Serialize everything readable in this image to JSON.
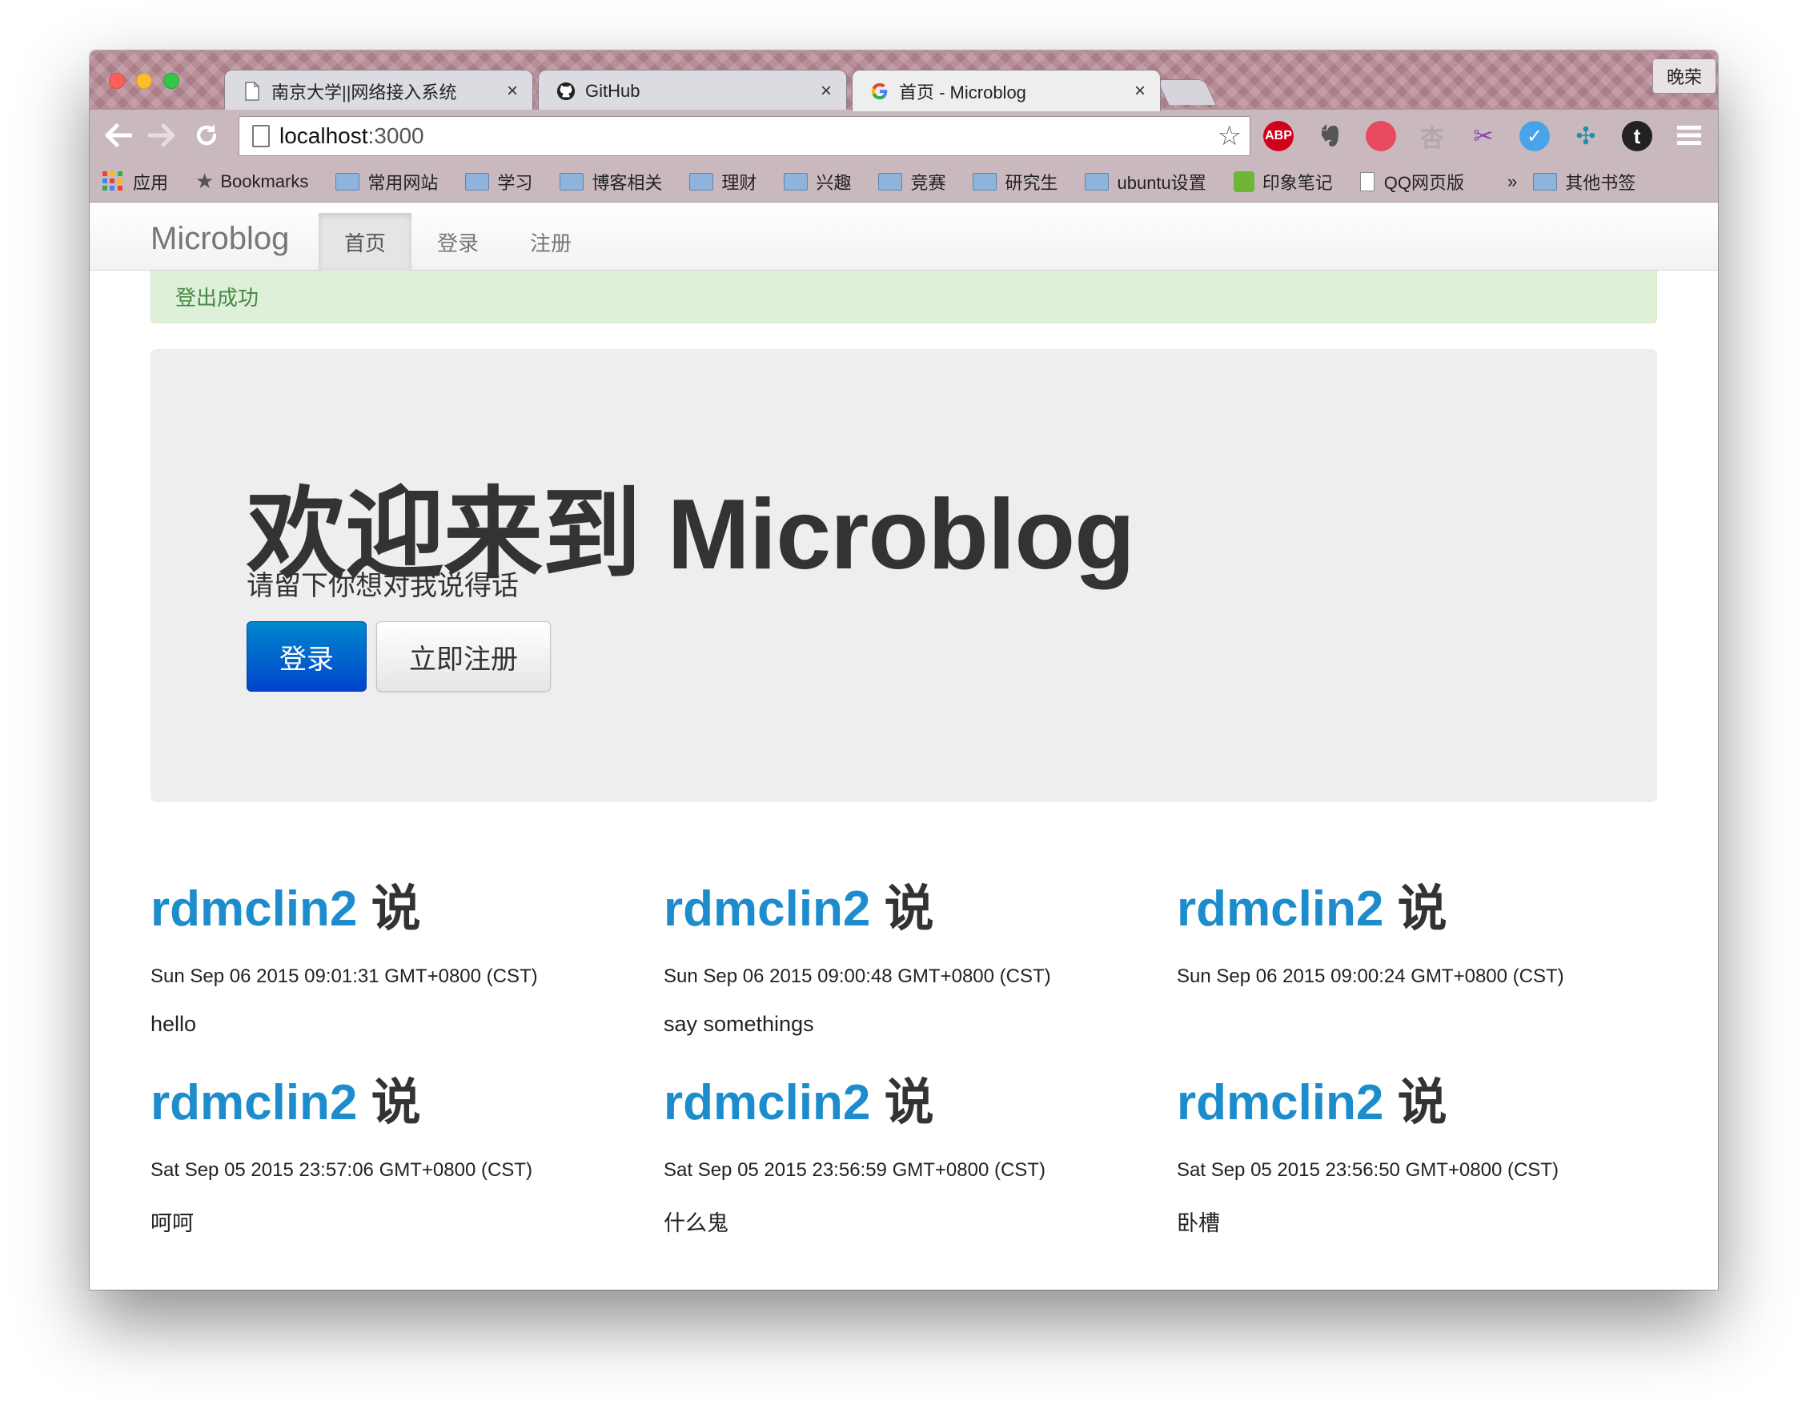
{
  "browser": {
    "profile_name": "晚荣",
    "tabs": [
      {
        "title": "南京大学||网络接入系统",
        "close": "×",
        "active": false,
        "icon": "page-icon"
      },
      {
        "title": "GitHub",
        "close": "×",
        "active": false,
        "icon": "github-icon"
      },
      {
        "title": "首页 - Microblog",
        "close": "×",
        "active": true,
        "icon": "google-icon"
      }
    ],
    "address": {
      "host": "localhost",
      "port": ":3000"
    },
    "extensions": [
      {
        "name": "adblock-plus-icon",
        "label": "ABP",
        "color": "#d0021b"
      },
      {
        "name": "evernote-icon",
        "label": "",
        "color": "#555555"
      },
      {
        "name": "red-extension-icon",
        "label": "",
        "color": "#e84a5f"
      },
      {
        "name": "grey-extension-icon",
        "label": "",
        "color": "#b0a8ab"
      },
      {
        "name": "purple-extension-icon",
        "label": "",
        "color": "#8e3fb0"
      },
      {
        "name": "blue-extension-icon",
        "label": "",
        "color": "#4aa3e8"
      },
      {
        "name": "network-extension-icon",
        "label": "",
        "color": "#1f8fb0"
      },
      {
        "name": "tumblr-icon",
        "label": "t",
        "color": "#222222"
      }
    ],
    "bookmarks": [
      {
        "label": "应用",
        "type": "apps"
      },
      {
        "label": "Bookmarks",
        "type": "star"
      },
      {
        "label": "常用网站",
        "type": "folder"
      },
      {
        "label": "学习",
        "type": "folder"
      },
      {
        "label": "博客相关",
        "type": "folder"
      },
      {
        "label": "理财",
        "type": "folder"
      },
      {
        "label": "兴趣",
        "type": "folder"
      },
      {
        "label": "竞赛",
        "type": "folder"
      },
      {
        "label": "研究生",
        "type": "folder"
      },
      {
        "label": "ubuntu设置",
        "type": "folder"
      },
      {
        "label": "印象笔记",
        "type": "evernote"
      },
      {
        "label": "QQ网页版",
        "type": "doc"
      }
    ],
    "bookmarks_more": "»",
    "other_bookmarks": "其他书签"
  },
  "navbar": {
    "brand": "Microblog",
    "items": [
      {
        "label": "首页",
        "active": true
      },
      {
        "label": "登录",
        "active": false
      },
      {
        "label": "注册",
        "active": false
      }
    ]
  },
  "alert": {
    "message": "登出成功",
    "color": "#468847"
  },
  "hero": {
    "title": "欢迎来到 Microblog",
    "subtitle": "请留下你想对我说得话",
    "login_button": "登录",
    "register_button": "立即注册"
  },
  "posts": [
    {
      "author": "rdmclin2",
      "says": "说",
      "time": "Sun Sep 06 2015 09:01:31 GMT+0800 (CST)",
      "text": "hello"
    },
    {
      "author": "rdmclin2",
      "says": "说",
      "time": "Sun Sep 06 2015 09:00:48 GMT+0800 (CST)",
      "text": "say somethings"
    },
    {
      "author": "rdmclin2",
      "says": "说",
      "time": "Sun Sep 06 2015 09:00:24 GMT+0800 (CST)",
      "text": ""
    },
    {
      "author": "rdmclin2",
      "says": "说",
      "time": "Sat Sep 05 2015 23:57:06 GMT+0800 (CST)",
      "text": "呵呵"
    },
    {
      "author": "rdmclin2",
      "says": "说",
      "time": "Sat Sep 05 2015 23:56:59 GMT+0800 (CST)",
      "text": "什么鬼"
    },
    {
      "author": "rdmclin2",
      "says": "说",
      "time": "Sat Sep 05 2015 23:56:50 GMT+0800 (CST)",
      "text": "卧槽"
    }
  ],
  "colors": {
    "link": "#1c8ccc",
    "primary": "#0066cc",
    "alert_bg": "#dff0d8"
  }
}
